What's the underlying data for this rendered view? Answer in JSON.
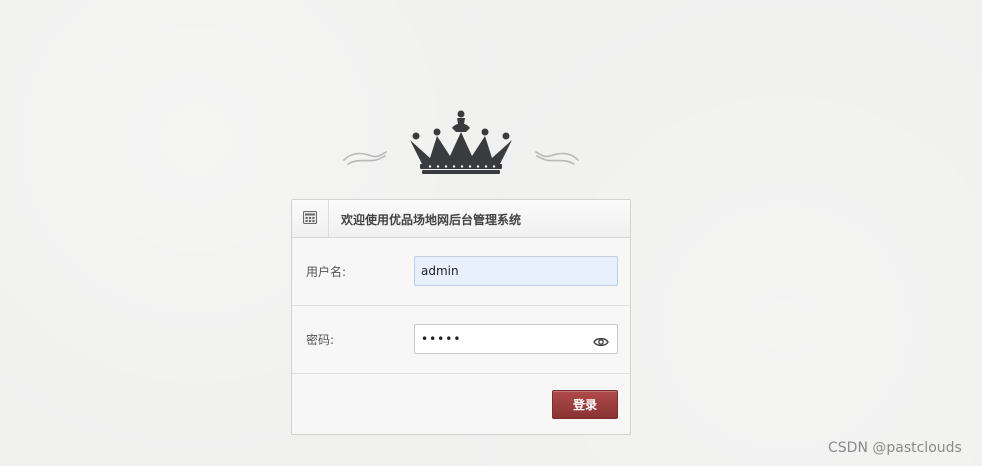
{
  "header": {
    "title": "欢迎使用优品场地网后台管理系统"
  },
  "form": {
    "username_label": "用户名:",
    "username_value": "admin",
    "password_label": "密码:",
    "password_value": "admin",
    "login_button": "登录"
  },
  "watermark": "CSDN @pastclouds",
  "icons": {
    "logo": "crown-icon",
    "header": "building-icon",
    "password_toggle": "eye-icon"
  },
  "colors": {
    "button": "#963b3b",
    "username_bg": "#e8f0fe",
    "crown": "#3a3b3f"
  }
}
